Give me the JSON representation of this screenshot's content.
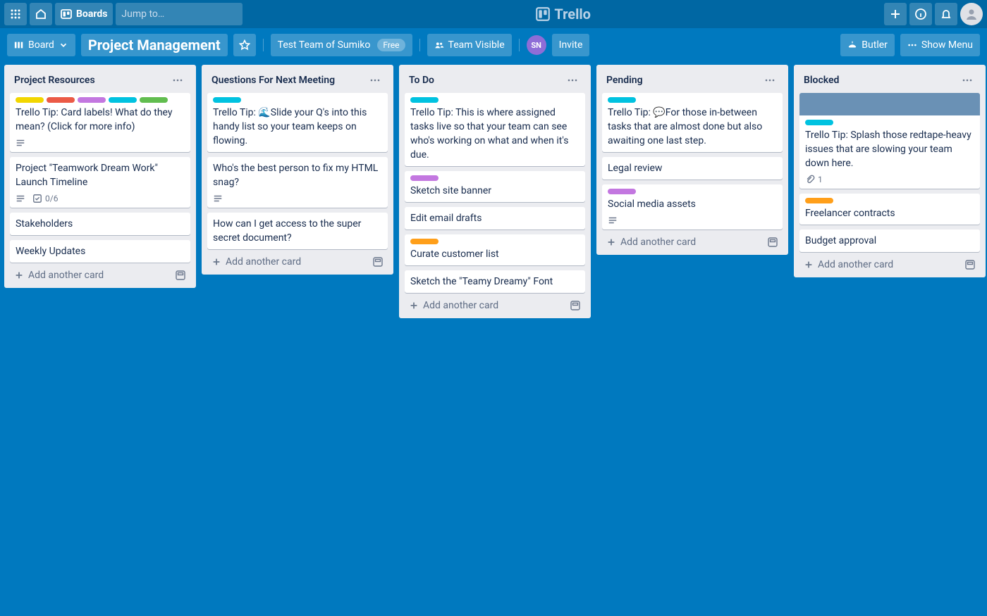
{
  "app": {
    "name": "Trello"
  },
  "header": {
    "boards_label": "Boards",
    "search_placeholder": "Jump to…"
  },
  "boardbar": {
    "view_label": "Board",
    "board_title": "Project Management",
    "team_label": "Test Team of Sumiko",
    "team_plan": "Free",
    "visibility": "Team Visible",
    "member_initials": "SN",
    "invite_label": "Invite",
    "butler_label": "Butler",
    "show_menu_label": "Show Menu"
  },
  "lists": [
    {
      "title": "Project Resources",
      "cards": [
        {
          "labels": [
            "yellow",
            "red",
            "purple",
            "sky",
            "green"
          ],
          "title": "Trello Tip: Card labels! What do they mean? (Click for more info)",
          "desc": true
        },
        {
          "title": "Project \"Teamwork Dream Work\" Launch Timeline",
          "desc": true,
          "checklist": "0/6"
        },
        {
          "title": "Stakeholders"
        },
        {
          "title": "Weekly Updates"
        }
      ]
    },
    {
      "title": "Questions For Next Meeting",
      "cards": [
        {
          "labels": [
            "sky"
          ],
          "title": "Trello Tip: 🌊Slide your Q's into this handy list so your team keeps on flowing."
        },
        {
          "title": "Who's the best person to fix my HTML snag?",
          "desc": true
        },
        {
          "title": "How can I get access to the super secret document?"
        }
      ]
    },
    {
      "title": "To Do",
      "cards": [
        {
          "labels": [
            "sky"
          ],
          "title": "Trello Tip: This is where assigned tasks live so that your team can see who's working on what and when it's due."
        },
        {
          "labels": [
            "purple"
          ],
          "title": "Sketch site banner"
        },
        {
          "title": "Edit email drafts"
        },
        {
          "labels": [
            "orange"
          ],
          "title": "Curate customer list"
        },
        {
          "title": "Sketch the \"Teamy Dreamy\" Font"
        }
      ]
    },
    {
      "title": "Pending",
      "cards": [
        {
          "labels": [
            "sky"
          ],
          "title": "Trello Tip: 💬For those in-between tasks that are almost done but also awaiting one last step."
        },
        {
          "title": "Legal review"
        },
        {
          "labels": [
            "purple"
          ],
          "title": "Social media assets",
          "desc": true
        }
      ]
    },
    {
      "title": "Blocked",
      "cards": [
        {
          "cover": true,
          "labels": [
            "sky"
          ],
          "title": "Trello Tip: Splash those redtape-heavy issues that are slowing your team down here.",
          "attachments": "1"
        },
        {
          "labels": [
            "orange"
          ],
          "title": "Freelancer contracts"
        },
        {
          "title": "Budget approval"
        }
      ]
    }
  ],
  "common": {
    "add_card": "Add another card"
  }
}
